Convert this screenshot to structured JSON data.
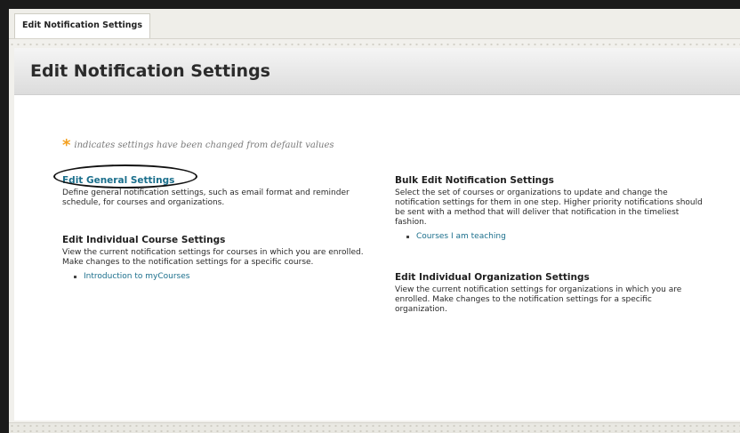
{
  "tab": {
    "label": "Edit Notification Settings"
  },
  "page": {
    "title": "Edit Notification Settings"
  },
  "legend": {
    "marker": "*",
    "text": "indicates settings have been changed from default values"
  },
  "general": {
    "title": "Edit General Settings",
    "description": "Define general notification settings, such as email format and reminder schedule, for courses and organizations."
  },
  "individual_course": {
    "title": "Edit Individual Course Settings",
    "description": "View the current notification settings for courses in which you are enrolled. Make changes to the notification settings for a specific course.",
    "items": [
      {
        "label": "Introduction to myCourses"
      }
    ]
  },
  "bulk": {
    "title": "Bulk Edit Notification Settings",
    "description": "Select the set of courses or organizations to update and change the notification settings for them in one step. Higher priority notifications should be sent with a method that will deliver that notification in the timeliest fashion.",
    "items": [
      {
        "label": "Courses I am teaching"
      }
    ]
  },
  "individual_org": {
    "title": "Edit Individual Organization Settings",
    "description": "View the current notification settings for organizations in which you are enrolled. Make changes to the notification settings for a specific organization."
  },
  "colors": {
    "link": "#1b6f8c",
    "star": "#f4a01f"
  }
}
